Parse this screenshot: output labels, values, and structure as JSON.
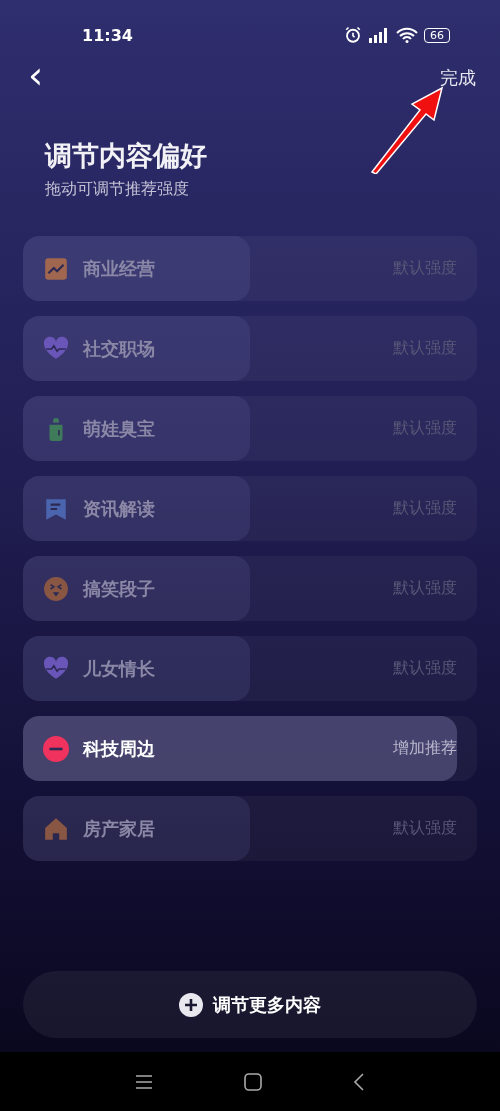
{
  "status_bar": {
    "time": "11:34",
    "battery": "66"
  },
  "header": {
    "back": "‹",
    "done": "完成"
  },
  "title": "调节内容偏好",
  "subtitle": "拖动可调节推荐强度",
  "categories": [
    {
      "name": "商业经营",
      "kind": "chart",
      "color": "#a0664f",
      "reading": "默认强度",
      "level": 0.5,
      "highlighted": false
    },
    {
      "name": "社交职场",
      "kind": "heart",
      "color": "#6a55b8",
      "reading": "默认强度",
      "level": 0.5,
      "highlighted": false
    },
    {
      "name": "萌娃臭宝",
      "kind": "bottle",
      "color": "#3f7a5a",
      "reading": "默认强度",
      "level": 0.5,
      "highlighted": false
    },
    {
      "name": "资讯解读",
      "kind": "note",
      "color": "#4a64ae",
      "reading": "默认强度",
      "level": 0.5,
      "highlighted": false
    },
    {
      "name": "搞笑段子",
      "kind": "laugh",
      "color": "#8a5644",
      "reading": "默认强度",
      "level": 0.5,
      "highlighted": false
    },
    {
      "name": "儿女情长",
      "kind": "heart",
      "color": "#6a55b8",
      "reading": "默认强度",
      "level": 0.5,
      "highlighted": false
    },
    {
      "name": "科技周边",
      "kind": "minus",
      "color": "#f0325e",
      "reading": "增加推荐",
      "level": 0.955,
      "highlighted": true
    },
    {
      "name": "房产家居",
      "kind": "house",
      "color": "#8a5644",
      "reading": "默认强度",
      "level": 0.5,
      "highlighted": false
    }
  ],
  "more_button": {
    "label": "调节更多内容"
  },
  "annotation": {
    "kind": "arrow"
  }
}
